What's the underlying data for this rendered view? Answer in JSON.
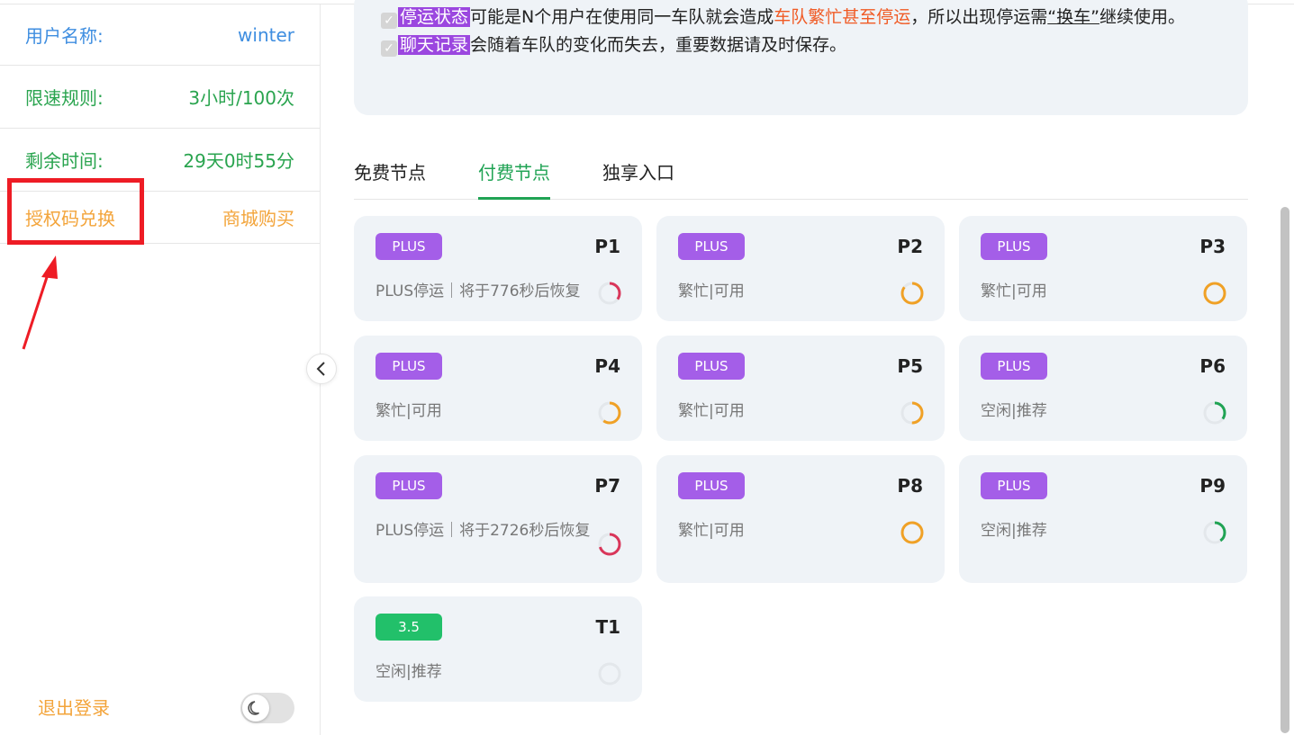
{
  "sidebar": {
    "user_label": "用户名称:",
    "user_value": "winter",
    "limit_label": "限速规则:",
    "limit_value": "3小时/100次",
    "remain_label": "剩余时间:",
    "remain_value": "29天0时55分",
    "redeem_label": "授权码兑换",
    "shop_label": "商城购买",
    "logout_label": "退出登录"
  },
  "notice": {
    "line1_tag": "停运状态",
    "line1_a": "可能是N个用户在使用同一车队就会造成",
    "line1_red": "车队繁忙甚至停运",
    "line1_b": "，所以出现停运需",
    "line1_under": "“换车”",
    "line1_c": "继续使用。",
    "line2_tag": "聊天记录",
    "line2_a": "会随着车队的变化而失去，重要数据请及时保存。"
  },
  "tabs": [
    {
      "label": "免费节点",
      "active": false
    },
    {
      "label": "付费节点",
      "active": true
    },
    {
      "label": "独享入口",
      "active": false
    }
  ],
  "cards": [
    {
      "badge": "PLUS",
      "name": "P1",
      "status": "PLUS停运｜将于776秒后恢复",
      "load": 0.35,
      "color": "#d9365a"
    },
    {
      "badge": "PLUS",
      "name": "P2",
      "status": "繁忙|可用",
      "load": 0.85,
      "color": "#f0a126"
    },
    {
      "badge": "PLUS",
      "name": "P3",
      "status": "繁忙|可用",
      "load": 1.0,
      "color": "#f0a126"
    },
    {
      "badge": "PLUS",
      "name": "P4",
      "status": "繁忙|可用",
      "load": 0.6,
      "color": "#f0a126"
    },
    {
      "badge": "PLUS",
      "name": "P5",
      "status": "繁忙|可用",
      "load": 0.5,
      "color": "#f0a126"
    },
    {
      "badge": "PLUS",
      "name": "P6",
      "status": "空闲|推荐",
      "load": 0.35,
      "color": "#20a354"
    },
    {
      "badge": "PLUS",
      "name": "P7",
      "status": "PLUS停运｜将于2726秒后恢复",
      "load": 0.7,
      "color": "#d9365a"
    },
    {
      "badge": "PLUS",
      "name": "P8",
      "status": "繁忙|可用",
      "load": 1.0,
      "color": "#f0a126"
    },
    {
      "badge": "PLUS",
      "name": "P9",
      "status": "空闲|推荐",
      "load": 0.4,
      "color": "#20a354"
    },
    {
      "badge": "3.5",
      "name": "T1",
      "status": "空闲|推荐",
      "load": 0.0,
      "color": "#20a354"
    }
  ]
}
